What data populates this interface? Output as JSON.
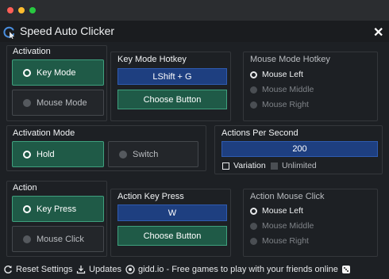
{
  "window": {
    "traffic_light_colors": [
      "#ff5f57",
      "#febc2e",
      "#28c840"
    ],
    "app_icon": "cursor-click-icon",
    "title": "Speed Auto Clicker",
    "close_label": "✕"
  },
  "activation": {
    "label": "Activation",
    "key_mode": "Key Mode",
    "mouse_mode": "Mouse Mode",
    "selected": "Key Mode"
  },
  "key_mode_hotkey": {
    "label": "Key Mode Hotkey",
    "value": "LShift + G",
    "choose_label": "Choose Button"
  },
  "mouse_mode_hotkey": {
    "label": "Mouse Mode Hotkey",
    "options": [
      "Mouse Left",
      "Mouse Middle",
      "Mouse Right"
    ],
    "selected": "Mouse Left"
  },
  "activation_mode": {
    "label": "Activation Mode",
    "hold": "Hold",
    "switch": "Switch",
    "selected": "Hold"
  },
  "actions_per_second": {
    "label": "Actions Per Second",
    "value": "200",
    "variation_label": "Variation",
    "variation_checked": false,
    "unlimited_label": "Unlimited",
    "unlimited_checked": false
  },
  "action": {
    "label": "Action",
    "key_press": "Key Press",
    "mouse_click": "Mouse Click",
    "selected": "Key Press"
  },
  "action_key_press": {
    "label": "Action Key Press",
    "value": "W",
    "choose_label": "Choose Button"
  },
  "action_mouse_click": {
    "label": "Action Mouse Click",
    "options": [
      "Mouse Left",
      "Mouse Middle",
      "Mouse Right"
    ],
    "selected": "Mouse Left"
  },
  "footer": {
    "reset": "Reset Settings",
    "updates": "Updates",
    "promo": "gidd.io - Free games to play with your friends online"
  },
  "colors": {
    "accent_green": "#1f5a47",
    "accent_green_border": "#3fa07e",
    "field_blue": "#1e3f80",
    "background": "#1d2024"
  }
}
